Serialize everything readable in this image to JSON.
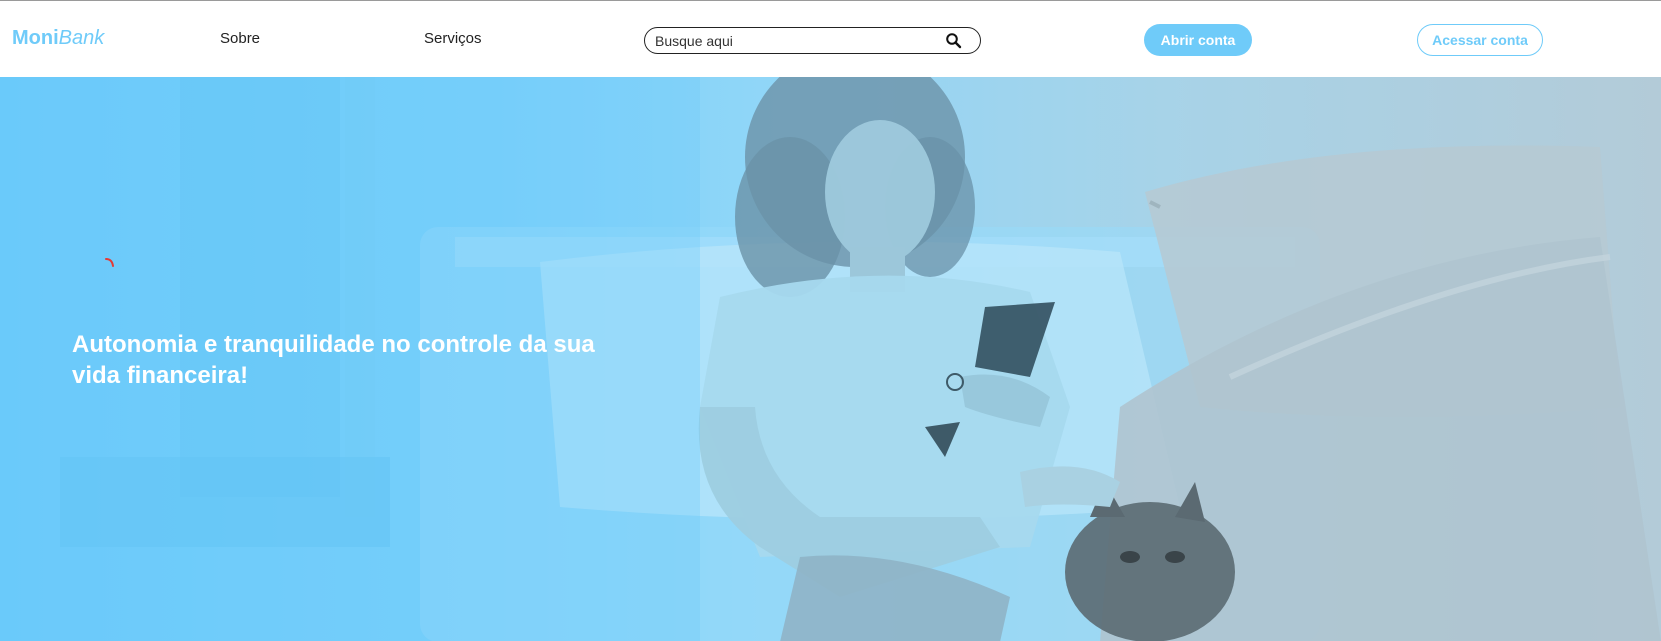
{
  "brand": {
    "name_bold": "Moni",
    "name_italic": "Bank",
    "accent_color": "#6fcbf9"
  },
  "nav": {
    "items": [
      {
        "label": "Sobre"
      },
      {
        "label": "Serviços"
      }
    ]
  },
  "search": {
    "placeholder": "Busque aqui",
    "value": "",
    "icon": "search-icon"
  },
  "actions": {
    "open_account_label": "Abrir conta",
    "access_account_label": "Acessar conta"
  },
  "hero": {
    "title": "Autonomia e tranquilidade no controle da sua vida financeira!",
    "overlay_color": "#6fcbf9",
    "loading_indicator_color": "#e53935"
  }
}
